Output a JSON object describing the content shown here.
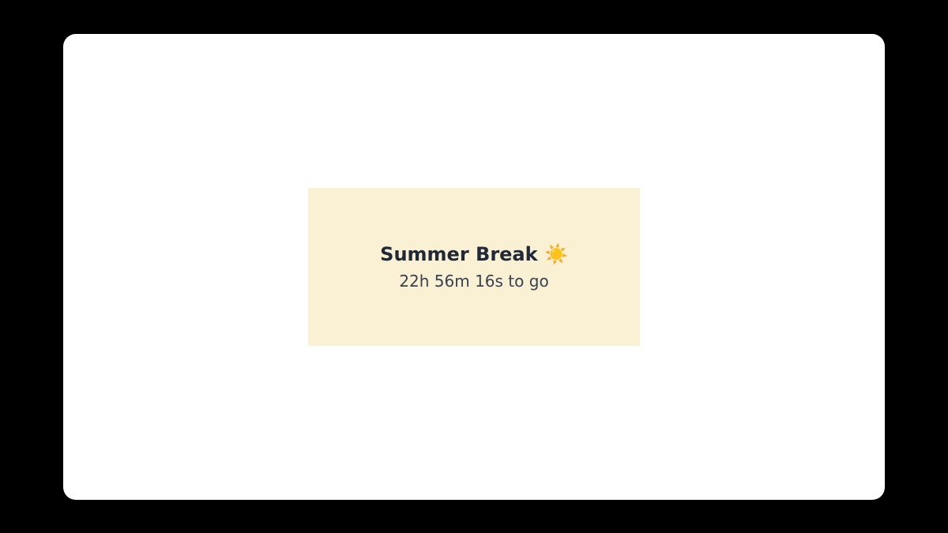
{
  "card": {
    "title": "Summer Break ☀️",
    "countdown": "22h 56m 16s to go"
  }
}
